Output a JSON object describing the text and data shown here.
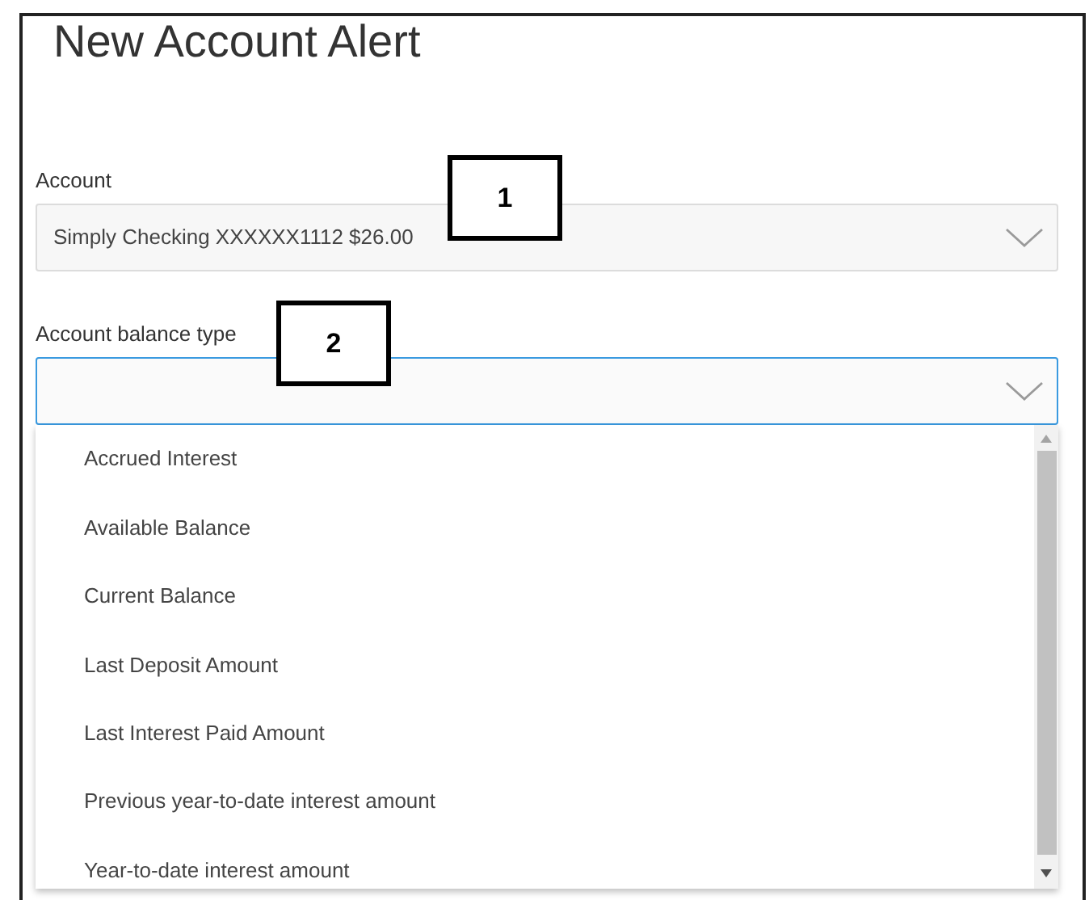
{
  "title": "New Account Alert",
  "fields": [
    {
      "label": "Account",
      "value": "Simply Checking XXXXXX1112 $26.00",
      "focused": false
    },
    {
      "label": "Account balance type",
      "focused": true
    }
  ],
  "options": [
    {
      "label": "Accrued Interest",
      "selected": false
    },
    {
      "label": "Available Balance",
      "selected": false
    },
    {
      "label": "Current Balance",
      "selected": false
    },
    {
      "label": "Last Deposit Amount",
      "selected": false
    },
    {
      "label": "Last Interest Paid Amount",
      "selected": false
    },
    {
      "label": "Previous year-to-date interest amount",
      "selected": false
    },
    {
      "label": "Year-to-date interest amount",
      "selected": false
    }
  ],
  "callouts": [
    {
      "label": "1"
    },
    {
      "label": "2"
    }
  ]
}
